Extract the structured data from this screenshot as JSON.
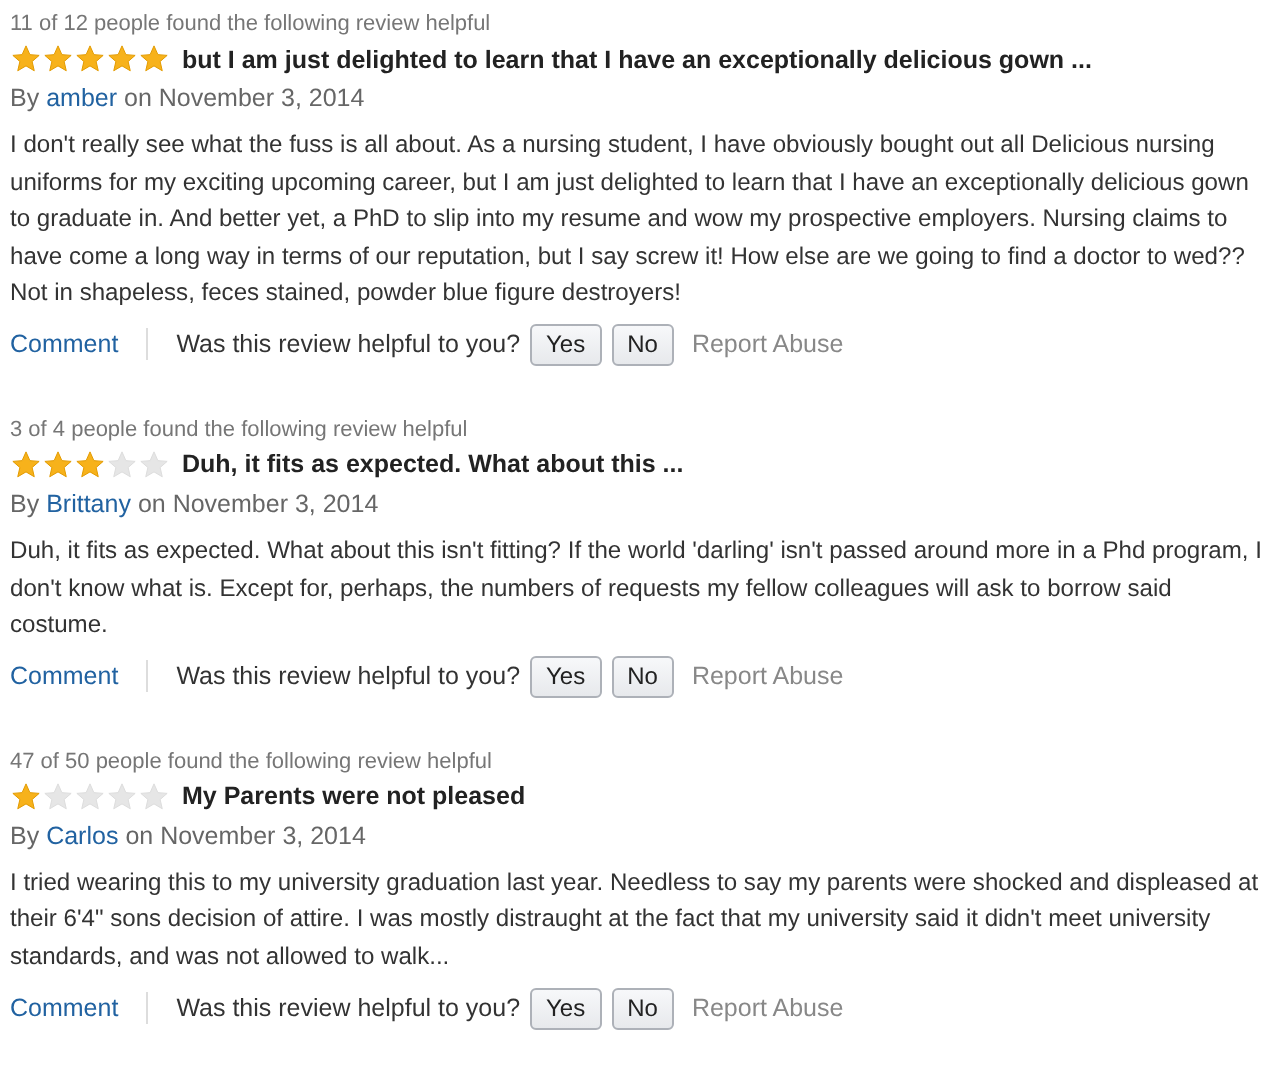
{
  "reviews": [
    {
      "helpful": "11 of 12 people found the following review helpful",
      "stars": 5,
      "title": "but I am just delighted to learn that I have an exceptionally delicious gown ...",
      "by": "By",
      "author": "amber",
      "date": "on November 3, 2014",
      "body": "I don't really see what the fuss is all about. As a nursing student, I have obviously bought out all Delicious nursing uniforms for my exciting upcoming career, but I am just delighted to learn that I have an exceptionally delicious gown to graduate in. And better yet, a PhD to slip into my resume and wow my prospective employers. Nursing claims to have come a long way in terms of our reputation, but I say screw it! How else are we going to find a doctor to wed?? Not in shapeless, feces stained, powder blue figure destroyers!",
      "comment": "Comment",
      "question": "Was this review helpful to you?",
      "yes": "Yes",
      "no": "No",
      "report": "Report Abuse"
    },
    {
      "helpful": "3 of 4 people found the following review helpful",
      "stars": 3,
      "title": "Duh, it fits as expected. What about this ...",
      "by": "By",
      "author": "Brittany",
      "date": "on November 3, 2014",
      "body": "Duh, it fits as expected. What about this isn't fitting? If the world 'darling' isn't passed around more in a Phd program, I don't know what is. Except for, perhaps, the numbers of requests my fellow colleagues will ask to borrow said costume.",
      "comment": "Comment",
      "question": "Was this review helpful to you?",
      "yes": "Yes",
      "no": "No",
      "report": "Report Abuse"
    },
    {
      "helpful": "47 of 50 people found the following review helpful",
      "stars": 1,
      "title": "My Parents were not pleased",
      "by": "By",
      "author": "Carlos",
      "date": "on November 3, 2014",
      "body": "I tried wearing this to my university graduation last year. Needless to say my parents were shocked and displeased at their 6'4\" sons decision of attire. I was mostly distraught at the fact that my university said it didn't meet university standards, and was not allowed to walk...",
      "comment": "Comment",
      "question": "Was this review helpful to you?",
      "yes": "Yes",
      "no": "No",
      "report": "Report Abuse"
    }
  ]
}
